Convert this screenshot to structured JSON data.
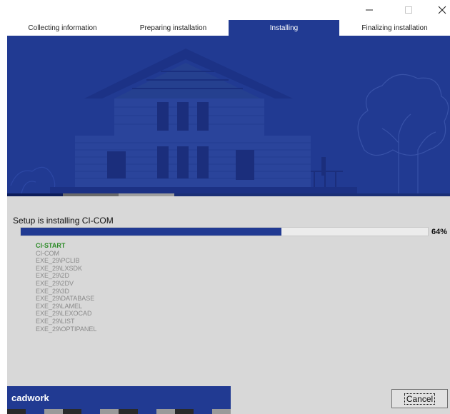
{
  "window": {
    "minimize_icon": "minimize-icon",
    "maximize_icon": "maximize-icon",
    "close_icon": "close-icon"
  },
  "steps": [
    {
      "label": "Collecting information",
      "active": false
    },
    {
      "label": "Preparing installation",
      "active": false
    },
    {
      "label": "Installing",
      "active": true
    },
    {
      "label": "Finalizing installation",
      "active": false
    }
  ],
  "status_text": "Setup is installing CI-COM",
  "progress": {
    "value": 0.64,
    "label": "64%"
  },
  "components": [
    {
      "label": "CI-START",
      "current": true
    },
    {
      "label": "CI-COM",
      "current": false
    },
    {
      "label": "EXE_29\\PCLIB",
      "current": false
    },
    {
      "label": "EXE_29\\LXSDK",
      "current": false
    },
    {
      "label": "EXE_29\\2D",
      "current": false
    },
    {
      "label": "EXE_29\\2DV",
      "current": false
    },
    {
      "label": "EXE_29\\3D",
      "current": false
    },
    {
      "label": "EXE_29\\DATABASE",
      "current": false
    },
    {
      "label": "EXE_29\\LAMEL",
      "current": false
    },
    {
      "label": "EXE_29\\LEXOCAD",
      "current": false
    },
    {
      "label": "EXE_29\\LIST",
      "current": false
    },
    {
      "label": "EXE_29\\OPTIPANEL",
      "current": false
    }
  ],
  "brand": "cadwork",
  "cancel_label": "Cancel",
  "colors": {
    "accent": "#213a92",
    "current_component": "#2a8a25",
    "pending_component": "#8a8a8a",
    "panel_background": "#d8d8d8"
  },
  "stripe_colors": [
    "#2a2a2a",
    "#213a92",
    "#9a9a9a",
    "#2a2a2a",
    "#213a92",
    "#9a9a9a",
    "#2a2a2a",
    "#213a92",
    "#9a9a9a",
    "#2a2a2a",
    "#213a92",
    "#9a9a9a"
  ]
}
